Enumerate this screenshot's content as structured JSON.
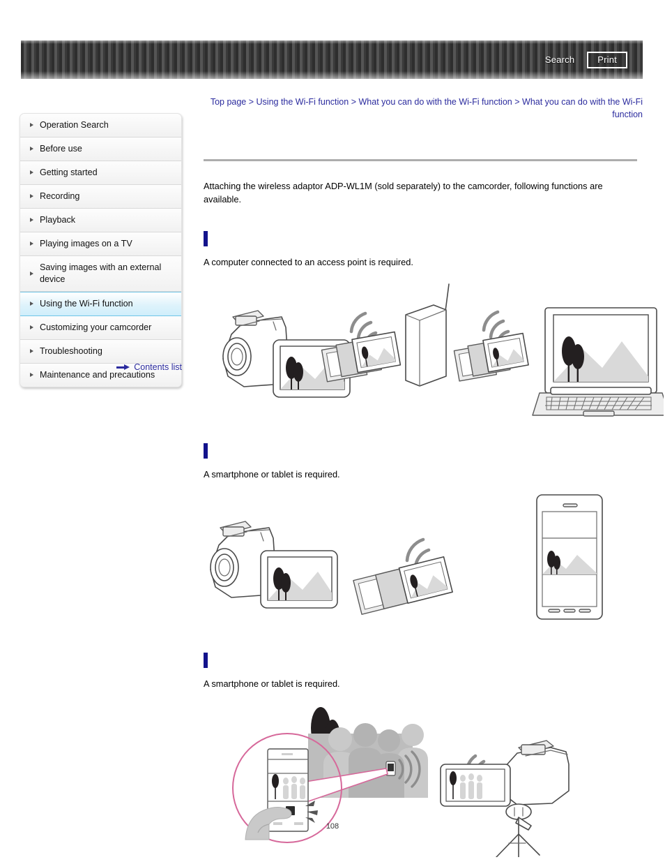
{
  "header": {
    "search_label": "Search",
    "print_label": "Print"
  },
  "breadcrumb": {
    "items": [
      "Top page",
      "Using the Wi-Fi function",
      "What you can do with the Wi-Fi function",
      "What you can do with the Wi-Fi function"
    ],
    "separator": ">"
  },
  "sidebar": {
    "items": [
      {
        "label": "Operation Search",
        "active": false
      },
      {
        "label": "Before use",
        "active": false
      },
      {
        "label": "Getting started",
        "active": false
      },
      {
        "label": "Recording",
        "active": false
      },
      {
        "label": "Playback",
        "active": false
      },
      {
        "label": "Playing images on a TV",
        "active": false
      },
      {
        "label": "Saving images with an external device",
        "active": false
      },
      {
        "label": "Using the Wi-Fi function",
        "active": true
      },
      {
        "label": "Customizing your camcorder",
        "active": false
      },
      {
        "label": "Troubleshooting",
        "active": false
      },
      {
        "label": "Maintenance and precautions",
        "active": false
      }
    ],
    "contents_list_label": "Contents list"
  },
  "main": {
    "intro": "Attaching the wireless adaptor ADP-WL1M (sold separately) to the camcorder, following functions are available.",
    "sections": [
      {
        "heading": "",
        "description": "A computer connected to an access point is required.",
        "figure": "camcorder-accesspoint-computer"
      },
      {
        "heading": "",
        "description": "A smartphone or tablet is required.",
        "figure": "camcorder-smartphone"
      },
      {
        "heading": "",
        "description": "A smartphone or tablet is required.",
        "figure": "smartphone-remote-camcorder-tripod"
      }
    ]
  },
  "footer": {
    "page_number": "108"
  },
  "colors": {
    "link": "#2b2b9e",
    "heading_bar": "#13138c",
    "active_nav": "#cfeefb",
    "rule": "#adadad"
  }
}
